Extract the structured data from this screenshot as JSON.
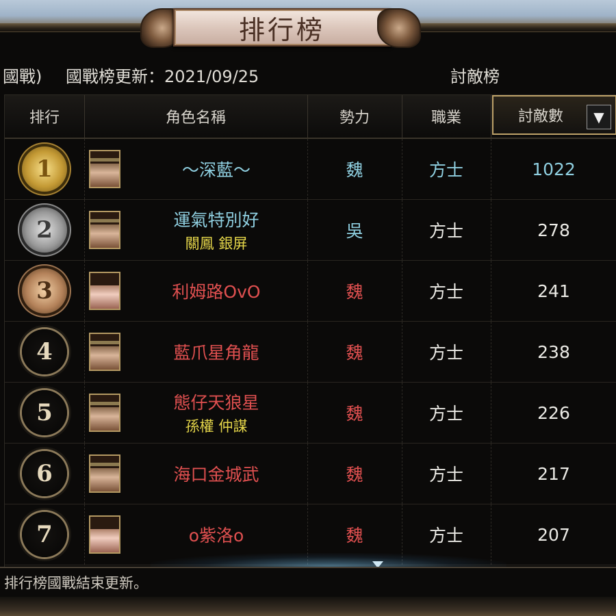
{
  "title": "排行榜",
  "info": {
    "fragment": "國戰)",
    "update_label": "國戰榜更新：2021/09/25",
    "board_name": "討敵榜"
  },
  "table": {
    "headers": {
      "rank": "排行",
      "name": "角色名稱",
      "faction": "勢力",
      "class": "職業",
      "kills": "討敵數",
      "sort_icon": "▼"
    },
    "rows": [
      {
        "rank": "1",
        "medal": "gold",
        "avatar": "male",
        "name": "～深藍～",
        "sub": "",
        "name_color": "blue",
        "faction": "魏",
        "faction_color": "blue",
        "class": "方士",
        "class_color": "blue",
        "kills": "1022",
        "kills_color": "blue"
      },
      {
        "rank": "2",
        "medal": "silver",
        "avatar": "male",
        "name": "運氣特別好",
        "sub": "關鳳 銀屏",
        "name_color": "blue",
        "faction": "吳",
        "faction_color": "blue",
        "class": "方士",
        "class_color": "white",
        "kills": "278",
        "kills_color": "white"
      },
      {
        "rank": "3",
        "medal": "bronze",
        "avatar": "female",
        "name": "利姆路OvO",
        "sub": "",
        "name_color": "red",
        "faction": "魏",
        "faction_color": "red",
        "class": "方士",
        "class_color": "white",
        "kills": "241",
        "kills_color": "white"
      },
      {
        "rank": "4",
        "medal": "plain",
        "avatar": "male",
        "name": "藍爪星角龍",
        "sub": "",
        "name_color": "red",
        "faction": "魏",
        "faction_color": "red",
        "class": "方士",
        "class_color": "white",
        "kills": "238",
        "kills_color": "white"
      },
      {
        "rank": "5",
        "medal": "plain",
        "avatar": "male",
        "name": "態仔天狼星",
        "sub": "孫權 仲謀",
        "name_color": "red",
        "faction": "魏",
        "faction_color": "red",
        "class": "方士",
        "class_color": "white",
        "kills": "226",
        "kills_color": "white"
      },
      {
        "rank": "6",
        "medal": "plain",
        "avatar": "male",
        "name": "海口金城武",
        "sub": "",
        "name_color": "red",
        "faction": "魏",
        "faction_color": "red",
        "class": "方士",
        "class_color": "white",
        "kills": "217",
        "kills_color": "white"
      },
      {
        "rank": "7",
        "medal": "plain",
        "avatar": "female",
        "name": "o紫洛o",
        "sub": "",
        "name_color": "red",
        "faction": "魏",
        "faction_color": "red",
        "class": "方士",
        "class_color": "white",
        "kills": "207",
        "kills_color": "white"
      }
    ]
  },
  "footer": {
    "note": "排行榜國戰結束更新。"
  },
  "colors": {
    "blue_text": "#8fcfe0",
    "red_text": "#e05050",
    "sub_text": "#e6d74a",
    "sort_border": "#bfa36a"
  }
}
